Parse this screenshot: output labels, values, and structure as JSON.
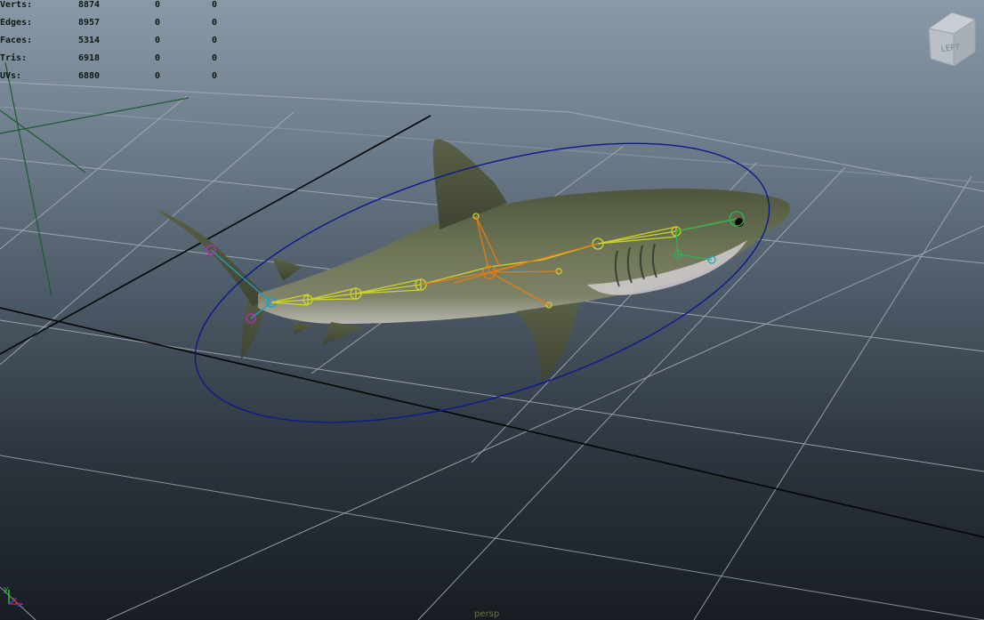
{
  "hud": {
    "rows": [
      {
        "label": "Verts:",
        "v1": "8874",
        "v2": "0",
        "v3": "0"
      },
      {
        "label": "Edges:",
        "v1": "8957",
        "v2": "0",
        "v3": "0"
      },
      {
        "label": "Faces:",
        "v1": "5314",
        "v2": "0",
        "v3": "0"
      },
      {
        "label": "Tris:",
        "v1": "6918",
        "v2": "0",
        "v3": "0"
      },
      {
        "label": "UVs:",
        "v1": "6880",
        "v2": "0",
        "v3": "0"
      }
    ]
  },
  "viewcube": {
    "face_label": "LEFT"
  },
  "camera": {
    "name": "persp"
  },
  "axis": {
    "x_label": "x",
    "y_label": "y",
    "z_label": "z"
  },
  "colors": {
    "grid": "#9aa4ad",
    "axis_lines": "#000000",
    "control_ring": "#0b1a8c",
    "shark_skin": "#6a7354",
    "joint_orange": "#e07a10",
    "joint_yellow": "#d4d62a",
    "joint_green": "#28b050",
    "joint_cyan": "#18a0c8",
    "joint_magenta": "#b030c0"
  }
}
